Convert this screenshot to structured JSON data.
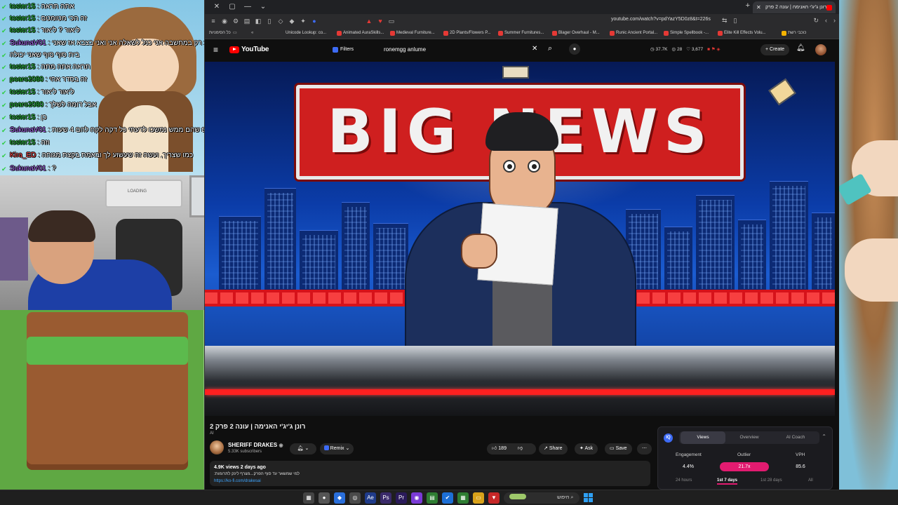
{
  "chat": {
    "messages": [
      {
        "user": "toster15",
        "text": "אתה תראה",
        "color": "green"
      },
      {
        "user": "toster15",
        "text": "זה הכי מטומטם",
        "color": "green"
      },
      {
        "user": "toster15",
        "text": "ליאור ? ליאור",
        "color": "green"
      },
      {
        "user": "SukunaV01",
        "text": "שמע רק במחשבה אני כנל לשאלה אני ואני בצבא אז שאני",
        "color": "purple"
      },
      {
        "user": "",
        "text": "בית סוף סוף שאני יכולה",
        "color": "green"
      },
      {
        "user": "toster15",
        "text": "תראה אתה מתה",
        "color": "green"
      },
      {
        "user": "poaro2080",
        "text": "זה בסדר אחי",
        "color": "green"
      },
      {
        "user": "toster15",
        "text": "ליאור ליאור",
        "color": "green"
      },
      {
        "user": "poaro2080",
        "text": "אבל דומה לשלך",
        "color": "green"
      },
      {
        "user": "toster15",
        "text": "כן",
        "color": "green"
      },
      {
        "user": "SukunaV01",
        "text": "רואים שהם ממש נמשכו לדעתי כל דקה לקח להם 4 שעות",
        "color": "purple"
      },
      {
        "user": "toster15",
        "text": "וזה",
        "color": "green"
      },
      {
        "user": "Kira_ED",
        "text": "כמו שצריך, ועשה זה שעשוע לך ובאמת בקצת מגוחה",
        "color": "red"
      },
      {
        "user": "SukunaV01",
        "text": "?",
        "color": "purple"
      }
    ]
  },
  "browser": {
    "tab_title": "רונן ג'יג'י האנימה | עונה 2 פרק",
    "url": "youtube.com/watch?v=pdYazY5D0z8&t=226s",
    "bookmarks": [
      "כל הסימניות",
      "Unicode Lookup: co...",
      "Animated AuraSkills...",
      "Medieval Furniture...",
      "2D Plants/Flowers P...",
      "Summer Furnitures...",
      "Blager Overhaul - M...",
      "Runic Ancient Portal...",
      "Simple Spellbook -...",
      "Elite Kill Effects Volu...",
      "כוכבי רשת"
    ]
  },
  "youtube": {
    "logo": "YouTube",
    "filters_label": "Filters",
    "search_value": "ronemgg anlume",
    "stats": [
      "37.7K",
      "28",
      "3,677"
    ],
    "create_label": "Create"
  },
  "video": {
    "banner_text": "BIG NEWS",
    "title": "רונן ג'יג'י האנימה | עונה 2 פרק 2",
    "ai_tag": "AI",
    "channel": "SHERIFF DRAKES",
    "subscribers": "5.33K subscribers",
    "remix_label": "Remix",
    "likes": "189",
    "share_label": "Share",
    "ask_label": "Ask",
    "save_label": "Save",
    "views_meta": "4.9K views  2 days ago",
    "description": "למי שמשאר עד סוף הפרק...מצרף לינק לתרומות:",
    "link": "https://ko-fi.com/drakesai"
  },
  "vidiq": {
    "tabs": [
      "Views",
      "Overview",
      "AI Coach"
    ],
    "engagement_label": "Engagement",
    "engagement_value": "4.4%",
    "outlier_label": "Outlier",
    "outlier_value": "21.7x",
    "vph_label": "VPH",
    "vph_value": "85.6",
    "ranges": [
      "24 hours",
      "1st 7 days",
      "1st 28 days",
      "All"
    ],
    "accent": "#e21b70"
  },
  "taskbar": {
    "search_placeholder": "חיפוש"
  },
  "webcam": {
    "loading_text": "LOADING"
  }
}
